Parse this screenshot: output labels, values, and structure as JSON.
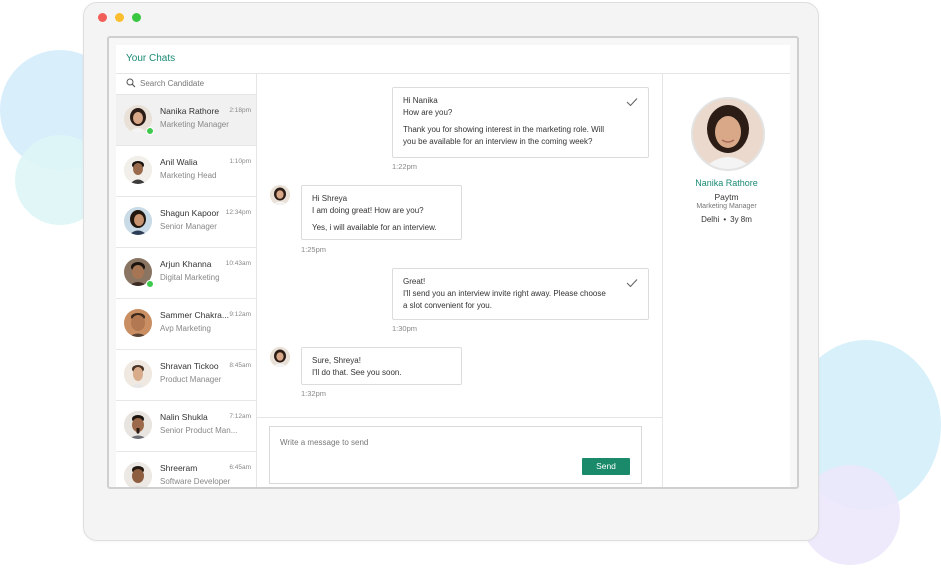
{
  "app": {
    "title": "Your Chats"
  },
  "search": {
    "placeholder": "Search Candidate"
  },
  "contacts": [
    {
      "name": "Nanika Rathore",
      "time": "2:18pm",
      "role": "Marketing Manager",
      "online": true,
      "active": true
    },
    {
      "name": "Anil Walia",
      "time": "1:10pm",
      "role": "Marketing Head",
      "online": false,
      "active": false
    },
    {
      "name": "Shagun Kapoor",
      "time": "12:34pm",
      "role": "Senior Manager",
      "online": false,
      "active": false
    },
    {
      "name": "Arjun Khanna",
      "time": "10:43am",
      "role": "Digital Marketing",
      "online": true,
      "active": false
    },
    {
      "name": "Sammer Chakra...",
      "time": "9:12am",
      "role": "Avp Marketing",
      "online": false,
      "active": false
    },
    {
      "name": "Shravan Tickoo",
      "time": "8:45am",
      "role": "Product Manager",
      "online": false,
      "active": false
    },
    {
      "name": "Nalin Shukla",
      "time": "7:12am",
      "role": "Senior Product Man...",
      "online": false,
      "active": false
    },
    {
      "name": "Shreeram",
      "time": "6:45am",
      "role": "Software Developer",
      "online": false,
      "active": false
    }
  ],
  "messages": [
    {
      "direction": "outgoing",
      "lines": [
        "Hi Nanika",
        "How are you?"
      ],
      "lines2": [
        "Thank you for showing interest in the marketing role. Will",
        "you be available for an interview in the coming week?"
      ],
      "time": "1:22pm"
    },
    {
      "direction": "incoming",
      "lines": [
        "Hi Shreya",
        "I am doing great! How are you?"
      ],
      "lines2": [
        "Yes, i will available for an interview."
      ],
      "time": "1:25pm"
    },
    {
      "direction": "outgoing",
      "lines": [
        "Great!",
        "I'll send you an interview invite right away. Please choose",
        "a slot convenient for you."
      ],
      "lines2": [],
      "time": "1:30pm"
    },
    {
      "direction": "incoming",
      "lines": [
        "Sure, Shreya!",
        "I'll do that. See you soon."
      ],
      "lines2": [],
      "time": "1:32pm"
    }
  ],
  "composer": {
    "placeholder": "Write a message to send",
    "send_label": "Send"
  },
  "profile": {
    "name": "Nanika Rathore",
    "company": "Paytm",
    "role": "Marketing Manager",
    "location": "Delhi",
    "separator": "•",
    "experience": "3y 8m"
  },
  "icons": [
    "search-icon",
    "check-icon"
  ],
  "colors": {
    "accent": "#1a8a74",
    "send_button": "#1a8a6a",
    "online": "#3cc94d"
  }
}
